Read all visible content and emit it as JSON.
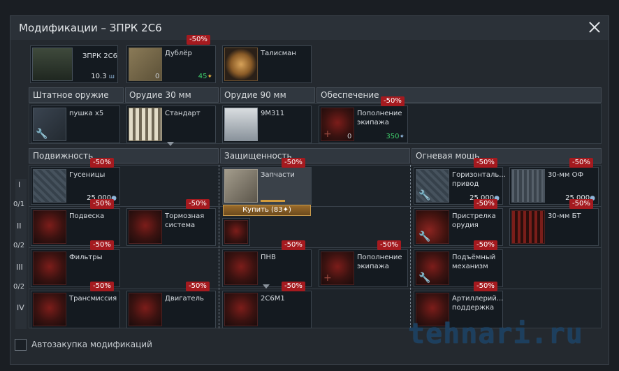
{
  "window": {
    "title": "Модификации – ЗПРК 2С6"
  },
  "vehicle": {
    "name": "ЗПРК 2С6",
    "rank": "10.3",
    "rank_icon": "ш"
  },
  "crew_cards": [
    {
      "name": "Дублёр",
      "count": "0",
      "price": "45",
      "currency": "golden-eagle",
      "discount": "-50%"
    },
    {
      "name": "Талисман"
    }
  ],
  "weapon_sections": [
    {
      "label": "Штатное оружие"
    },
    {
      "label": "Орудие 30 мм"
    },
    {
      "label": "Орудие 90 мм"
    },
    {
      "label": "Обеспечение"
    }
  ],
  "weapon_cards": [
    {
      "name": "пушка х5"
    },
    {
      "name": "Стандарт"
    },
    {
      "name": "9М311"
    },
    {
      "name": "Пополнение экипажа",
      "count": "0",
      "price": "350",
      "discount": "-50%"
    }
  ],
  "mod_sections": [
    {
      "label": "Подвижность"
    },
    {
      "label": "Защищенность"
    },
    {
      "label": "Огневая мощь"
    }
  ],
  "tiers": [
    "I",
    "II",
    "III",
    "IV"
  ],
  "tier_progress": [
    "0/1",
    "0/2",
    "0/2"
  ],
  "mods": {
    "mobility": [
      {
        "name": "Гусеницы",
        "price": "25 000",
        "discount": "-50%"
      },
      {
        "name": "Подвеска",
        "discount": "-50%"
      },
      {
        "name": "Тормозная система",
        "discount": "-50%"
      },
      {
        "name": "Фильтры",
        "discount": "-50%"
      },
      {
        "name": "Трансмиссия",
        "discount": "-50%"
      },
      {
        "name": "Двигатель",
        "discount": "-50%"
      }
    ],
    "protection": [
      {
        "name": "Запчасти",
        "discount": "-50%",
        "buy_label": "Купить (83",
        "buy_suffix": ")"
      },
      {
        "name": "ПНВ",
        "discount": "-50%"
      },
      {
        "name": "Пополнение экипажа",
        "discount": "-50%"
      },
      {
        "name": "2С6М1",
        "discount": "-50%"
      }
    ],
    "firepower": [
      {
        "name": "Горизонталь... привод",
        "price": "25 000",
        "discount": "-50%"
      },
      {
        "name": "30-мм ОФ",
        "price": "25 000",
        "discount": "-50%"
      },
      {
        "name": "Пристрелка орудия",
        "discount": "-50%"
      },
      {
        "name": "30-мм БТ",
        "discount": "-50%"
      },
      {
        "name": "Подъёмный механизм",
        "discount": "-50%"
      },
      {
        "name": "Артиллерий... поддержка",
        "discount": "-50%"
      }
    ]
  },
  "autobuy": {
    "label": "Автозакупка модификаций"
  },
  "watermark": "tehnari.ru",
  "colors": {
    "discount_badge": "#a51a1f",
    "accent_gold": "#d19b3c",
    "green_price": "#3fd06b"
  }
}
